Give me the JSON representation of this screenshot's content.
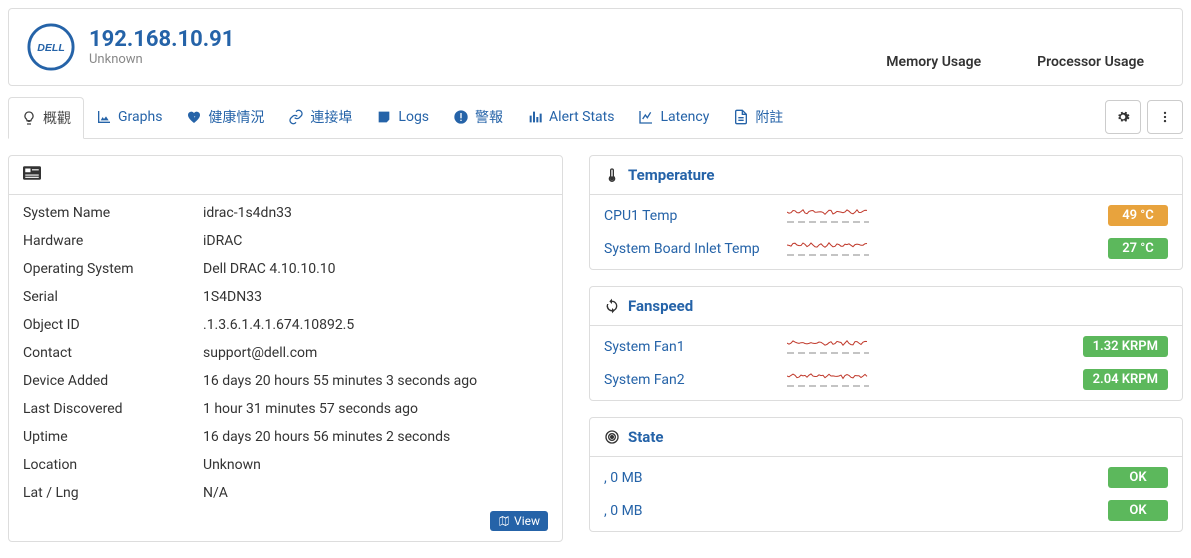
{
  "header": {
    "ip": "192.168.10.91",
    "subtitle": "Unknown",
    "metrics": {
      "memory": "Memory Usage",
      "processor": "Processor Usage"
    }
  },
  "tabs": {
    "overview": "概觀",
    "graphs": "Graphs",
    "health": "健康情況",
    "ports": "連接埠",
    "logs": "Logs",
    "alerts": "警報",
    "alert_stats": "Alert Stats",
    "latency": "Latency",
    "notes": "附註"
  },
  "details": {
    "rows": [
      {
        "k": "System Name",
        "v": "idrac-1s4dn33"
      },
      {
        "k": "Hardware",
        "v": "iDRAC"
      },
      {
        "k": "Operating System",
        "v": "Dell DRAC 4.10.10.10"
      },
      {
        "k": "Serial",
        "v": "1S4DN33"
      },
      {
        "k": "Object ID",
        "v": ".1.3.6.1.4.1.674.10892.5"
      },
      {
        "k": "Contact",
        "v": "support@dell.com"
      },
      {
        "k": "Device Added",
        "v": "16 days 20 hours 55 minutes 3 seconds ago"
      },
      {
        "k": "Last Discovered",
        "v": "1 hour 31 minutes 57 seconds ago"
      },
      {
        "k": "Uptime",
        "v": "16 days 20 hours 56 minutes 2 seconds"
      },
      {
        "k": "Location",
        "v": "Unknown"
      },
      {
        "k": "Lat / Lng",
        "v": "N/A"
      }
    ],
    "view_btn": "View"
  },
  "sensors": {
    "temperature": {
      "title": "Temperature",
      "items": [
        {
          "name": "CPU1 Temp",
          "value": "49 °C",
          "color": "orange"
        },
        {
          "name": "System Board Inlet Temp",
          "value": "27 °C",
          "color": "green"
        }
      ]
    },
    "fanspeed": {
      "title": "Fanspeed",
      "items": [
        {
          "name": "System Fan1",
          "value": "1.32 KRPM",
          "color": "green"
        },
        {
          "name": "System Fan2",
          "value": "2.04 KRPM",
          "color": "green"
        }
      ]
    },
    "state": {
      "title": "State",
      "items": [
        {
          "name": ", 0 MB",
          "value": "OK",
          "color": "green"
        },
        {
          "name": ", 0 MB",
          "value": "OK",
          "color": "green"
        }
      ]
    }
  }
}
